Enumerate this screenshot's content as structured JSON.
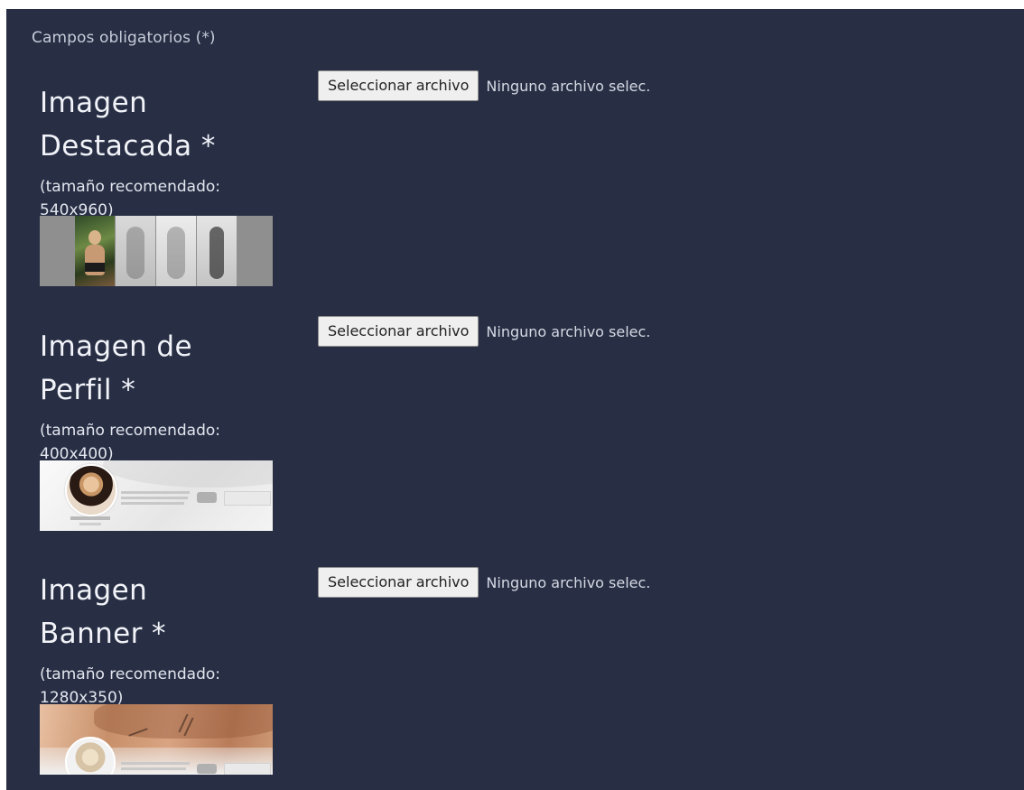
{
  "form": {
    "required_note": "Campos obligatorios (*)",
    "fields": [
      {
        "label_line1": "Imagen",
        "label_line2": "Destacada *",
        "hint_line1": "(tamaño recomendado:",
        "hint_line2": "540x960)",
        "button_label": "Seleccionar archivo",
        "status": "Ninguno archivo selec."
      },
      {
        "label_line1": "Imagen de",
        "label_line2": "Perfil *",
        "hint_line1": "(tamaño recomendado:",
        "hint_line2": "400x400)",
        "button_label": "Seleccionar archivo",
        "status": "Ninguno archivo selec."
      },
      {
        "label_line1": "Imagen",
        "label_line2": "Banner *",
        "hint_line1": "(tamaño recomendado:",
        "hint_line2": "1280x350)",
        "button_label": "Seleccionar archivo",
        "status": "Ninguno archivo selec."
      }
    ]
  },
  "colors": {
    "panel_background": "#282f45",
    "text_primary": "#f1f3f8",
    "button_background": "#efefef"
  },
  "icons": {
    "featured_preview": "featured-image-thumbnail",
    "profile_preview": "profile-image-thumbnail",
    "banner_preview": "banner-image-thumbnail"
  }
}
